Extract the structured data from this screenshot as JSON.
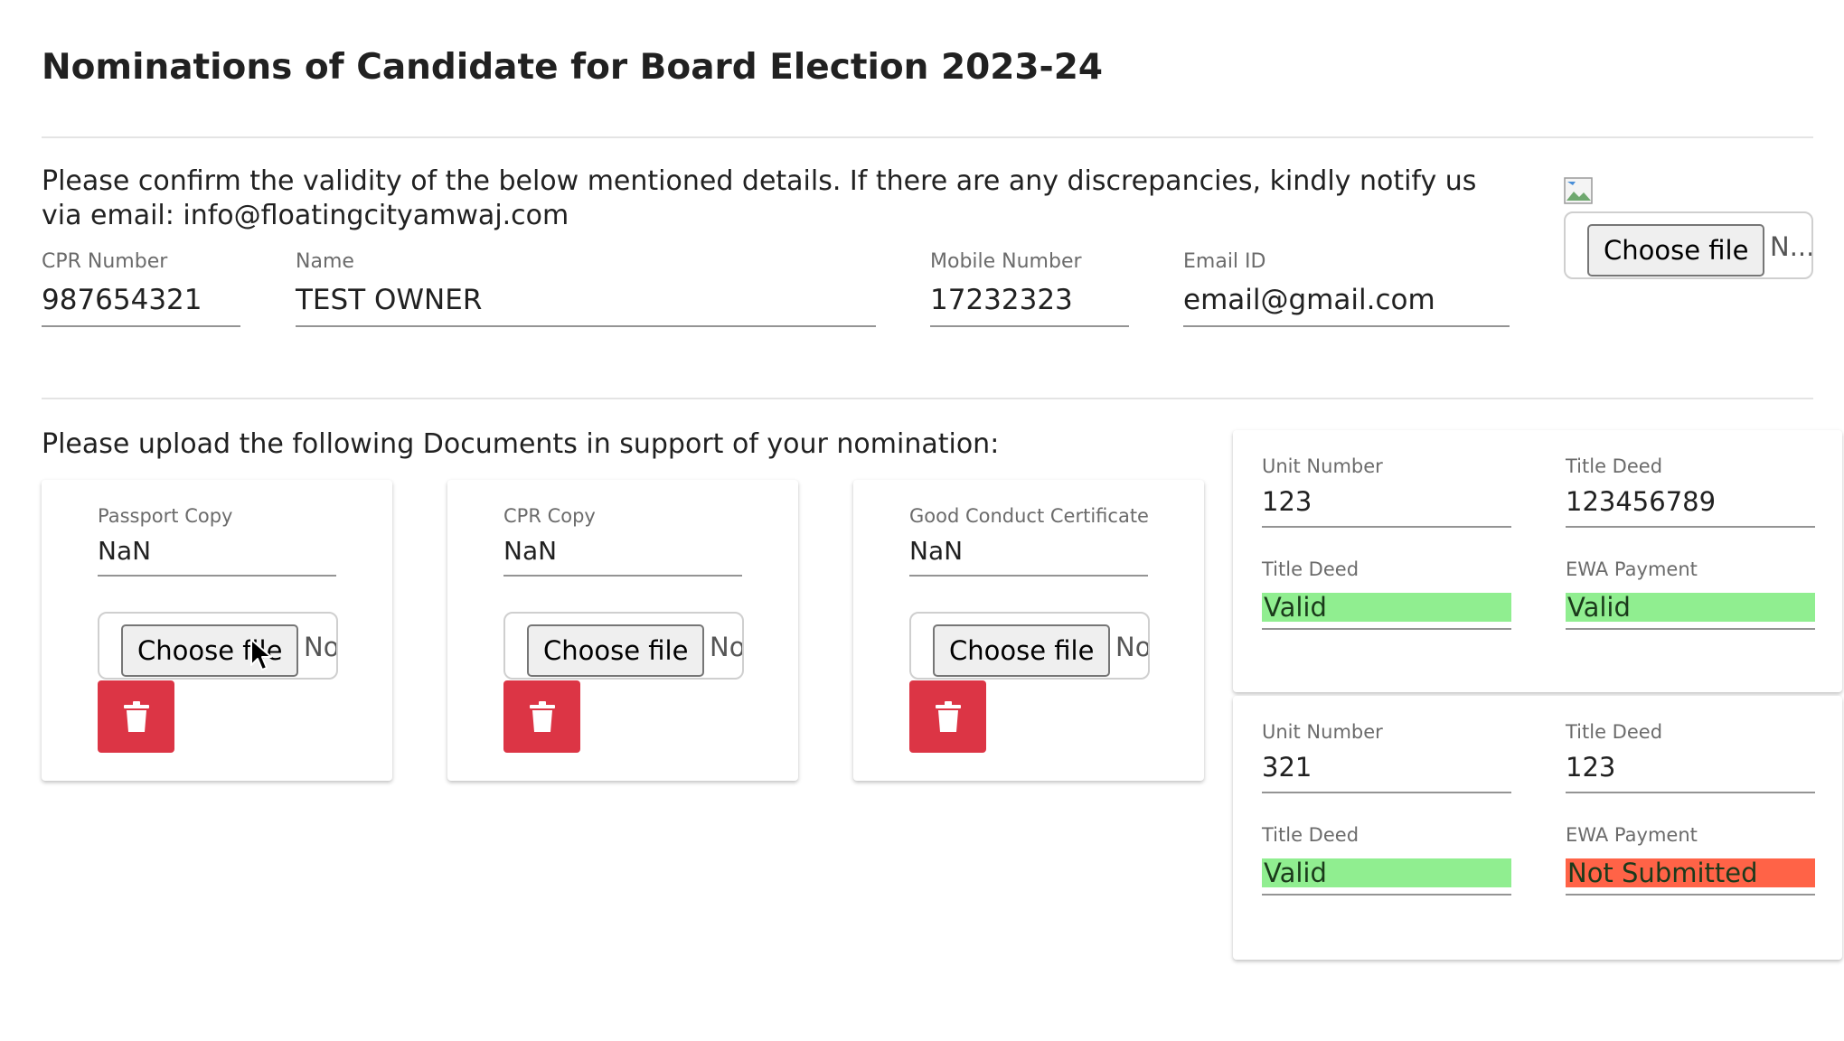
{
  "page": {
    "title": "Nominations of Candidate for Board Election 2023-24",
    "confirm_text": "Please confirm the validity of the below mentioned details. If there are any discrepancies, kindly notify us via email: info@floatingcityamwaj.com"
  },
  "owner": {
    "cpr_label": "CPR Number",
    "cpr_value": "987654321",
    "name_label": "Name",
    "name_value": "TEST OWNER",
    "mobile_label": "Mobile Number",
    "mobile_value": "17232323",
    "email_label": "Email ID",
    "email_value": "email@gmail.com"
  },
  "photo_upload": {
    "button_label": "Choose file",
    "file_status": "N..."
  },
  "documents": {
    "heading": "Please upload the following Documents in support of your nomination:",
    "items": [
      {
        "label": "Passport Copy",
        "value": "NaN",
        "button_label": "Choose file",
        "file_status": "No"
      },
      {
        "label": "CPR Copy",
        "value": "NaN",
        "button_label": "Choose file",
        "file_status": "No"
      },
      {
        "label": "Good Conduct Certificate",
        "value": "NaN",
        "button_label": "Choose file",
        "file_status": "No"
      }
    ]
  },
  "units": [
    {
      "unit_label": "Unit Number",
      "unit_value": "123",
      "deed_label": "Title Deed",
      "deed_value": "123456789",
      "deed_status_label": "Title Deed",
      "deed_status": "Valid",
      "ewa_label": "EWA Payment",
      "ewa_status": "Valid"
    },
    {
      "unit_label": "Unit Number",
      "unit_value": "321",
      "deed_label": "Title Deed",
      "deed_value": "123",
      "deed_status_label": "Title Deed",
      "deed_status": "Valid",
      "ewa_label": "EWA Payment",
      "ewa_status": "Not Submitted"
    }
  ],
  "colors": {
    "valid": "#90ee90",
    "not_submitted": "#ff6347",
    "delete": "#dc3545"
  },
  "icons": {
    "delete": "trash-icon",
    "cursor": "mouse-pointer",
    "photo": "broken-image-icon"
  }
}
